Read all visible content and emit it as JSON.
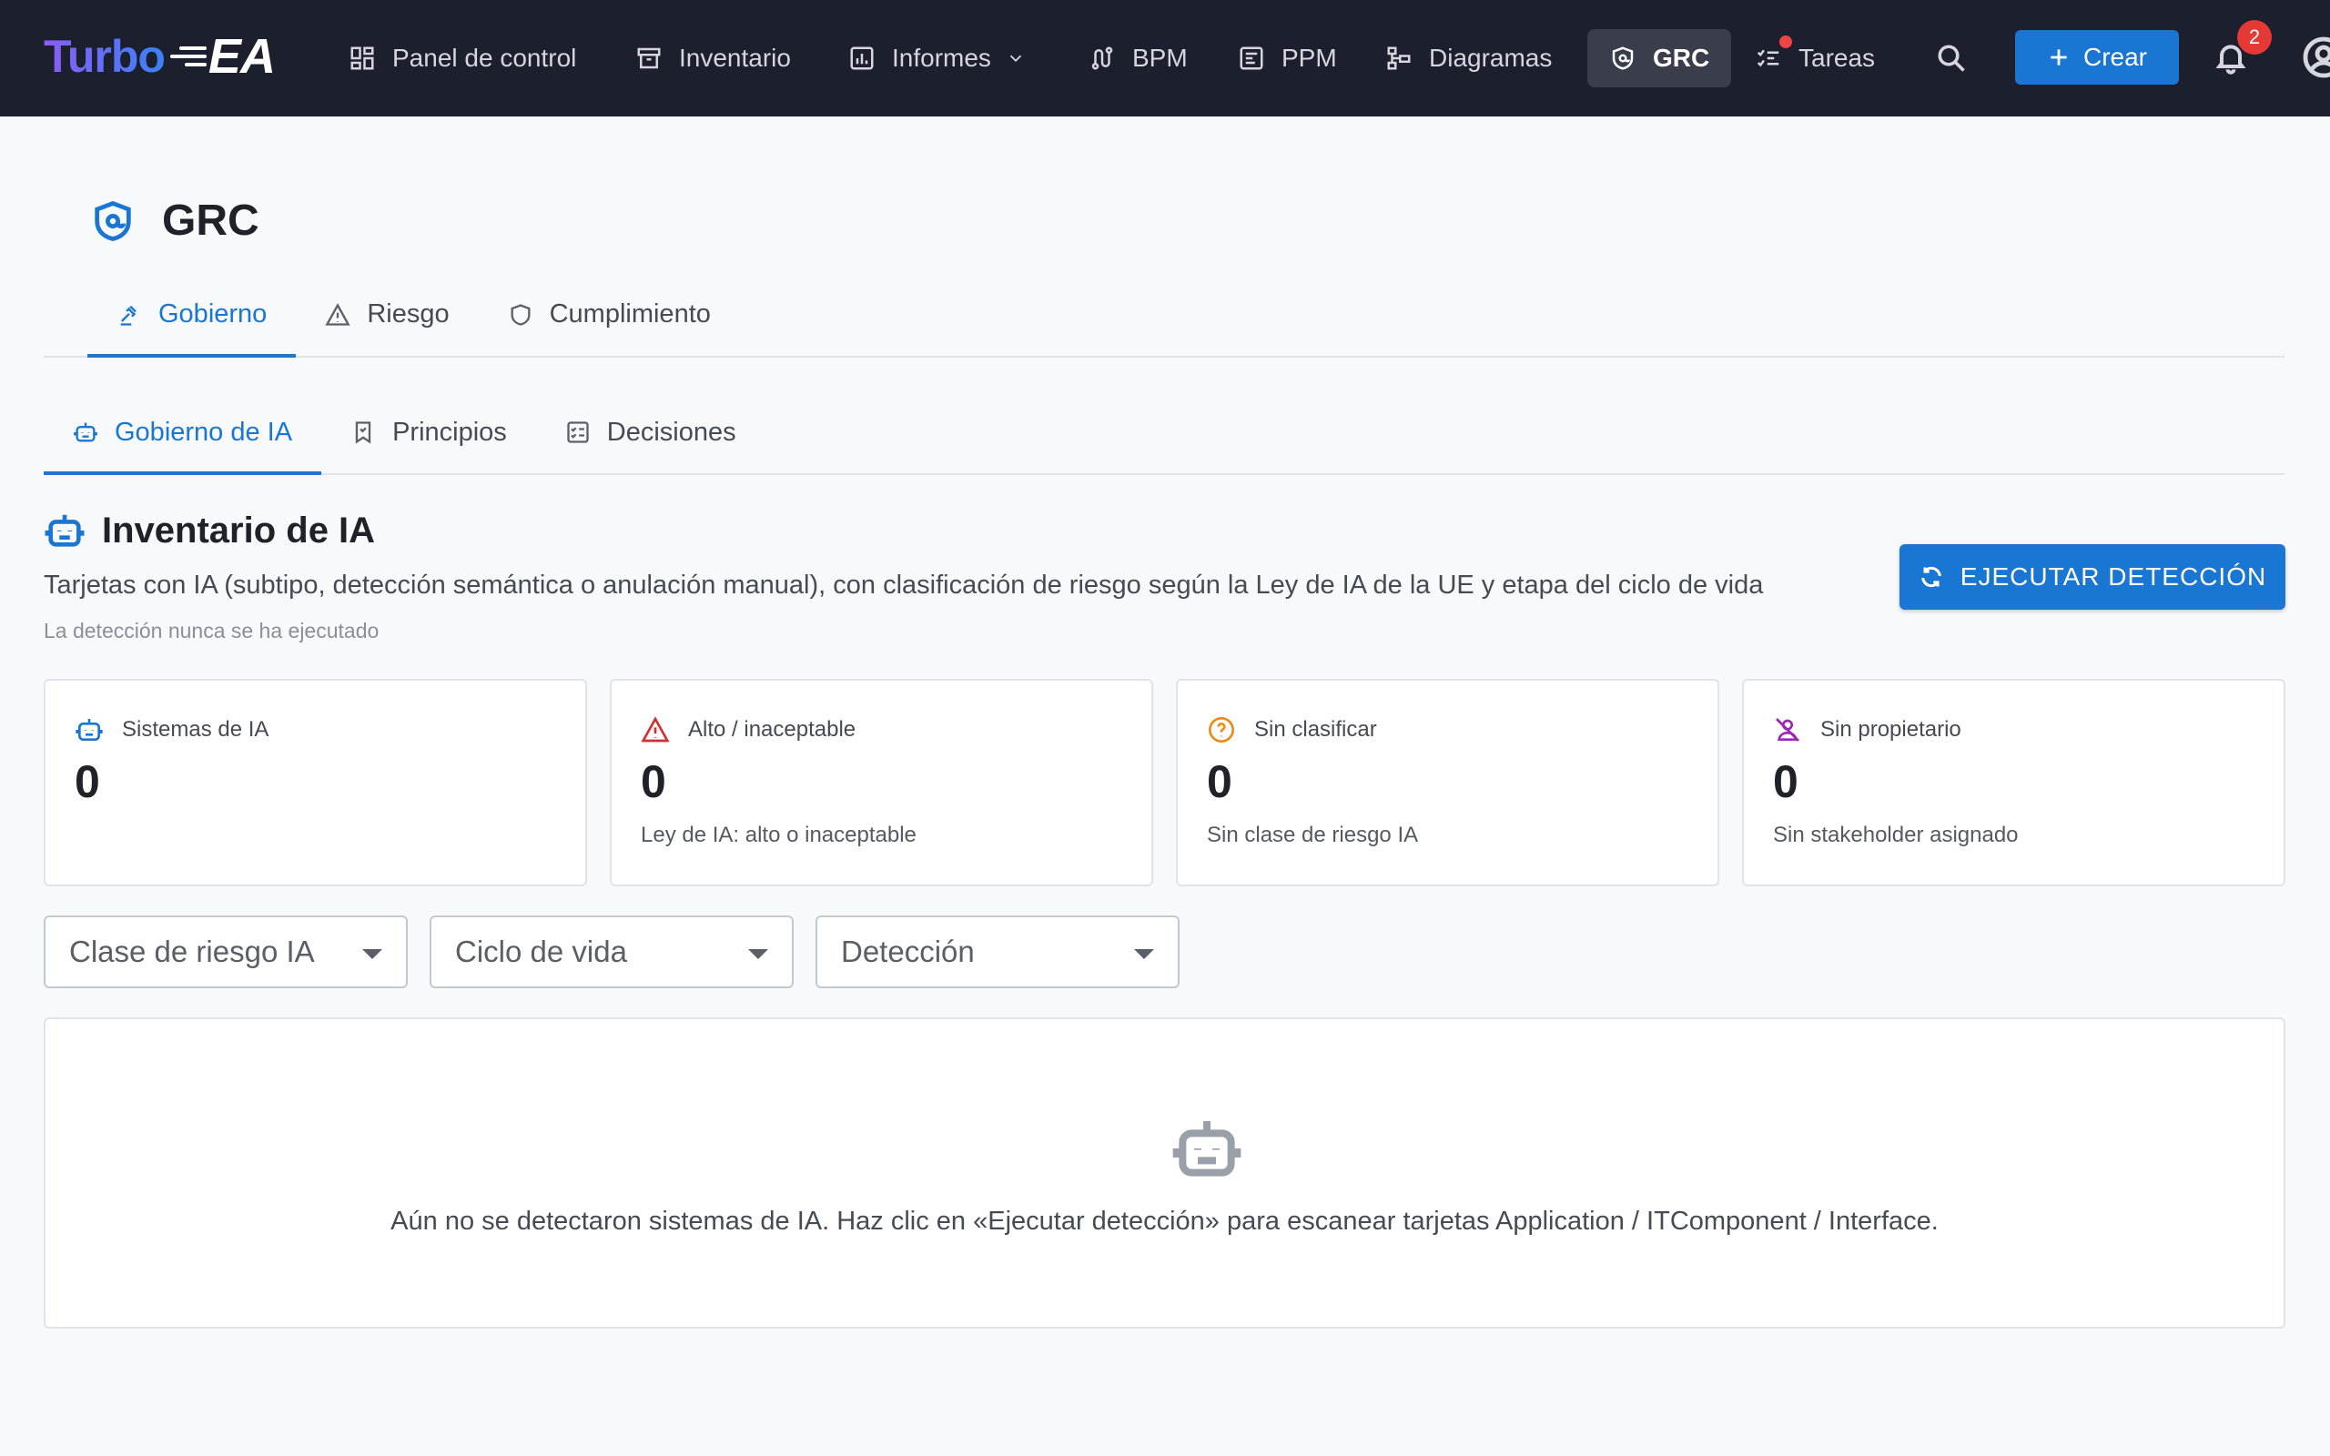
{
  "app": {
    "logo_turbo": "Turbo",
    "logo_ea": "EA"
  },
  "nav": {
    "items": [
      {
        "label": "Panel de control",
        "icon": "dashboard-icon"
      },
      {
        "label": "Inventario",
        "icon": "archive-icon"
      },
      {
        "label": "Informes",
        "icon": "bar-chart-icon"
      },
      {
        "label": "BPM",
        "icon": "route-icon"
      },
      {
        "label": "PPM",
        "icon": "project-icon"
      },
      {
        "label": "Diagramas",
        "icon": "diagram-icon"
      },
      {
        "label": "GRC",
        "icon": "shield-icon"
      },
      {
        "label": "Tareas",
        "icon": "checklist-icon"
      }
    ],
    "active": "GRC",
    "create_label": "Crear",
    "notifications_count": "2"
  },
  "page": {
    "title": "GRC",
    "tabs": [
      {
        "label": "Gobierno",
        "icon": "gavel-icon"
      },
      {
        "label": "Riesgo",
        "icon": "warning-icon"
      },
      {
        "label": "Cumplimiento",
        "icon": "shield-outline-icon"
      }
    ],
    "active_tab": "Gobierno",
    "subtabs": [
      {
        "label": "Gobierno de IA",
        "icon": "robot-icon"
      },
      {
        "label": "Principios",
        "icon": "bookmark-icon"
      },
      {
        "label": "Decisiones",
        "icon": "checklist-box-icon"
      }
    ],
    "active_subtab": "Gobierno de IA"
  },
  "section": {
    "title": "Inventario de IA",
    "description": "Tarjetas con IA (subtipo, detección semántica o anulación manual), con clasificación de riesgo según la Ley de IA de la UE y etapa del ciclo de vida",
    "note": "La detección nunca se ha ejecutado",
    "run_button": "EJECUTAR DETECCIÓN"
  },
  "kpis": [
    {
      "label": "Sistemas de IA",
      "value": "0",
      "sub": "",
      "icon": "robot-icon",
      "color": "#1976d2"
    },
    {
      "label": "Alto / inaceptable",
      "value": "0",
      "sub": "Ley de IA: alto o inaceptable",
      "icon": "warning-icon",
      "color": "#d32f2f"
    },
    {
      "label": "Sin clasificar",
      "value": "0",
      "sub": "Sin clase de riesgo IA",
      "icon": "help-circle-icon",
      "color": "#ef8a17"
    },
    {
      "label": "Sin propietario",
      "value": "0",
      "sub": "Sin stakeholder asignado",
      "icon": "person-off-icon",
      "color": "#9c27b0"
    }
  ],
  "filters": {
    "risk_class": "Clase de riesgo IA",
    "lifecycle": "Ciclo de vida",
    "detection": "Detección"
  },
  "empty_state": {
    "message": "Aún no se detectaron sistemas de IA. Haz clic en «Ejecutar detección» para escanear tarjetas Application / ITComponent / Interface."
  }
}
